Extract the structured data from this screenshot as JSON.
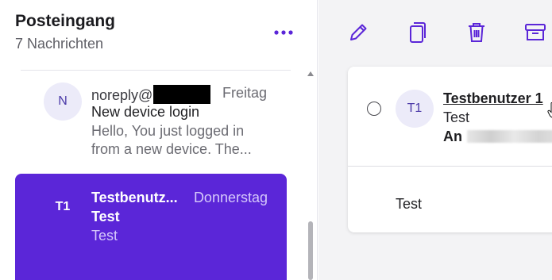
{
  "folder": {
    "title": "Posteingang",
    "count": "7 Nachrichten"
  },
  "messages": [
    {
      "initials": "N",
      "sender": "noreply@",
      "date": "Freitag",
      "subject": "New device login",
      "preview": "Hello, You just logged in from a new device. The..."
    },
    {
      "initials": "T1",
      "sender": "Testbenutz...",
      "date": "Donnerstag",
      "subject": "Test",
      "preview": "Test",
      "selected": true
    }
  ],
  "reader": {
    "initials": "T1",
    "sender": "Testbenutzer 1",
    "subject": "Test",
    "to_label": "An",
    "body": "Test"
  },
  "toolbar": [
    "edit-icon",
    "copy-icon",
    "trash-icon",
    "archive-icon"
  ],
  "colors": {
    "accent": "#5b26d8",
    "accent_text": "#d6c9fb",
    "avatar_bg": "#ecebf9"
  }
}
